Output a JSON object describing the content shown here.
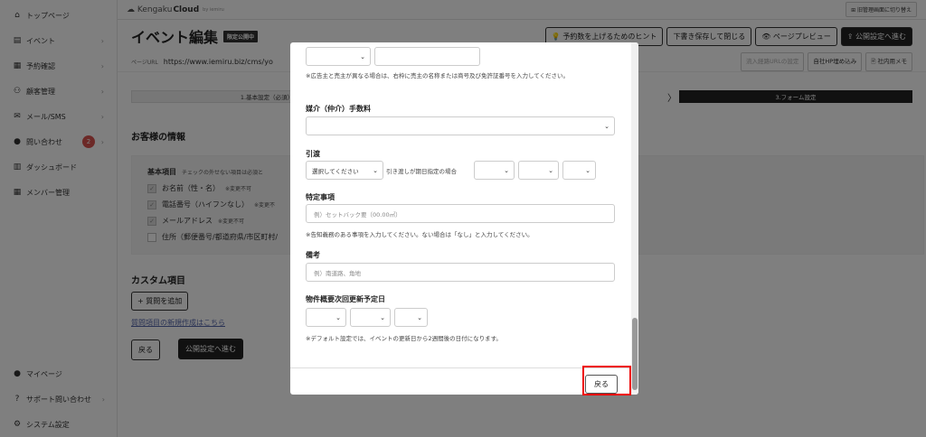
{
  "sidebar": {
    "items": [
      {
        "label": "トップページ",
        "icon": "home-icon",
        "glyph": "⌂"
      },
      {
        "label": "イベント",
        "icon": "document-icon",
        "glyph": "▤",
        "chev": "›"
      },
      {
        "label": "予約確認",
        "icon": "calendar-icon",
        "glyph": "▦",
        "chev": "›"
      },
      {
        "label": "顧客管理",
        "icon": "users-icon",
        "glyph": "⚇",
        "chev": "›"
      },
      {
        "label": "メール/SMS",
        "icon": "mail-icon",
        "glyph": "✉",
        "chev": "›"
      },
      {
        "label": "問い合わせ",
        "icon": "chat-icon",
        "glyph": "●",
        "badge": "2",
        "chev": "›"
      },
      {
        "label": "ダッシュボード",
        "icon": "chart-icon",
        "glyph": "▥"
      },
      {
        "label": "メンバー管理",
        "icon": "grid-icon",
        "glyph": "▦"
      }
    ],
    "bottom": [
      {
        "label": "マイページ",
        "icon": "person-icon",
        "glyph": "●"
      },
      {
        "label": "サポート問い合わせ",
        "icon": "question-icon",
        "glyph": "?",
        "chev": "›"
      },
      {
        "label": "システム設定",
        "icon": "gear-icon",
        "glyph": "⚙"
      }
    ]
  },
  "topbar": {
    "logo_a": "Kengaku",
    "logo_b": "Cloud",
    "logo_small": "by iemiru",
    "admin_label": "⊞ 旧管理画面に切り替え"
  },
  "header": {
    "title": "イベント編集",
    "status": "限定公開中",
    "buttons": [
      "💡 予約数を上げるためのヒント",
      "下書き保存して閉じる",
      "👁 ページプレビュー",
      "⇪ 公開設定へ進む"
    ]
  },
  "url": {
    "label": "ページURL",
    "value": "https://www.iemiru.biz/cms/yo",
    "buttons": [
      "流入経路URLの設定",
      "自社HP埋め込み",
      "🖹 社内用メモ"
    ]
  },
  "steps": {
    "one": "1.基本設定（必須）",
    "three": "3.フォーム設定",
    "arrow": "〉"
  },
  "customer": {
    "title": "お客様の情報",
    "basic_label": "基本項目",
    "basic_note": "チェックの外せない項目は必須と",
    "items": [
      {
        "label": "お名前（性・名）",
        "note": "※変更不可",
        "checked": true
      },
      {
        "label": "電話番号（ハイフンなし）",
        "note": "※変更不",
        "checked": true
      },
      {
        "label": "メールアドレス",
        "note": "※変更不可",
        "checked": true
      },
      {
        "label": "住所（郵便番号/都道府県/市区町村/",
        "note": "",
        "checked": false
      }
    ]
  },
  "custom": {
    "title": "カスタム項目",
    "add_button": "+ 質問を追加",
    "link": "質問項目の新規作成はこちら",
    "back": "戻る",
    "next": "公開設定へ進む"
  },
  "modal": {
    "top_note": "※広告主と売主が異なる場合は、右枠に売主の名称または商号及び免許証番号を入力してください。",
    "commission_label": "媒介（仲介）手数料",
    "handover_label": "引渡",
    "handover_select": "選択してください",
    "handover_text": "引き渡しが期日指定の場合",
    "special_label": "特定事項",
    "special_placeholder": "例）セットバック要（00.00㎡）",
    "special_note": "※告知義務のある事項を入力してください。ない場合は「なし」と入力してください。",
    "remarks_label": "備考",
    "remarks_placeholder": "例）南道路、角地",
    "next_update_label": "物件概要次回更新予定日",
    "update_note": "※デフォルト設定では、イベントの更新日から2週間後の日付になります。",
    "back": "戻る",
    "dd": "⌄"
  }
}
